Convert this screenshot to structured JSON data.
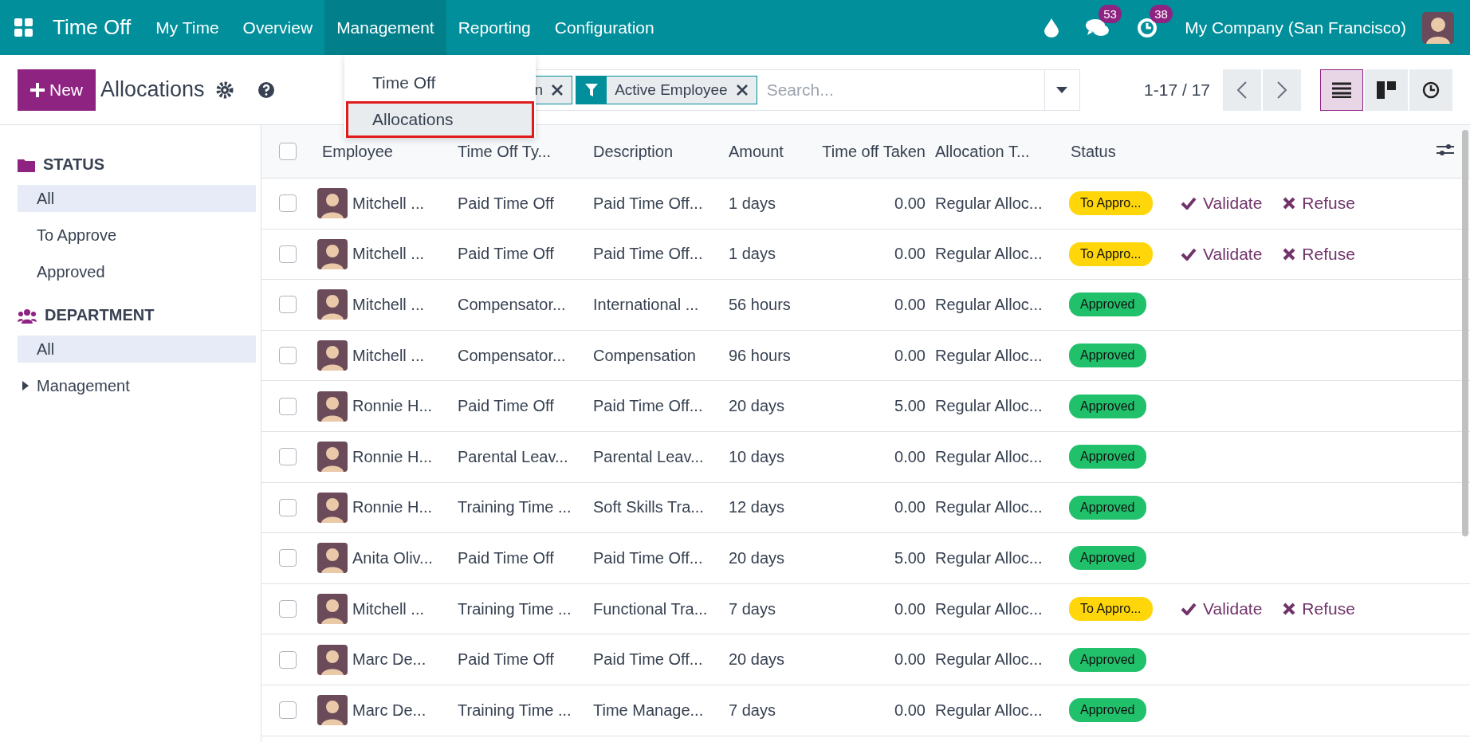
{
  "navbar": {
    "app_title": "Time Off",
    "menu": [
      {
        "label": "My Time",
        "selected": false
      },
      {
        "label": "Overview",
        "selected": false
      },
      {
        "label": "Management",
        "selected": true
      },
      {
        "label": "Reporting",
        "selected": false
      },
      {
        "label": "Configuration",
        "selected": false
      }
    ],
    "messages_badge": "53",
    "activities_badge": "38",
    "company": "My Company (San Francisco)"
  },
  "dropdown": {
    "items": [
      {
        "label": "Time Off",
        "selected": false
      },
      {
        "label": "Allocations",
        "selected": true
      }
    ]
  },
  "control_panel": {
    "new_button": "New",
    "title": "Allocations",
    "facets": [
      {
        "label": "n"
      },
      {
        "label": "Active Employee",
        "kind": "filter"
      }
    ],
    "search": {
      "placeholder": "Search..."
    },
    "pager": "1-17 / 17",
    "views": [
      {
        "kind": "list",
        "selected": true
      },
      {
        "kind": "kanban",
        "selected": false
      },
      {
        "kind": "activity",
        "selected": false
      }
    ]
  },
  "sidebar": [
    {
      "title": "STATUS",
      "kind": "folder",
      "items": [
        {
          "label": "All",
          "selected": true
        },
        {
          "label": "To Approve",
          "selected": false
        },
        {
          "label": "Approved",
          "selected": false
        }
      ]
    },
    {
      "title": "DEPARTMENT",
      "kind": "users",
      "items": [
        {
          "label": "All",
          "selected": true
        },
        {
          "label": "Management",
          "selected": false,
          "expanded": false
        }
      ]
    }
  ],
  "table": {
    "select_all_checked": false,
    "columns": [
      "Employee",
      "Time Off Ty...",
      "Description",
      "Amount",
      "Time off Taken",
      "Allocation T...",
      "Status"
    ],
    "rows": [
      {
        "checked": false,
        "employee": "Mitchell ...",
        "type": "Paid Time Off",
        "description": "Paid Time Off...",
        "amount": "1 days",
        "taken": "0.00",
        "allocation": "Regular Alloc...",
        "status": "To Appro...",
        "color": "#ffd60a",
        "actions": [
          "Validate",
          "Refuse"
        ]
      },
      {
        "checked": false,
        "employee": "Mitchell ...",
        "type": "Paid Time Off",
        "description": "Paid Time Off...",
        "amount": "1 days",
        "taken": "0.00",
        "allocation": "Regular Alloc...",
        "status": "To Appro...",
        "color": "#ffd60a",
        "actions": [
          "Validate",
          "Refuse"
        ]
      },
      {
        "checked": false,
        "employee": "Mitchell ...",
        "type": "Compensator...",
        "description": "International ...",
        "amount": "56 hours",
        "taken": "0.00",
        "allocation": "Regular Alloc...",
        "status": "Approved",
        "color": "#21c16b"
      },
      {
        "checked": false,
        "employee": "Mitchell ...",
        "type": "Compensator...",
        "description": "Compensation",
        "amount": "96 hours",
        "taken": "0.00",
        "allocation": "Regular Alloc...",
        "status": "Approved",
        "color": "#21c16b"
      },
      {
        "checked": false,
        "employee": "Ronnie H...",
        "type": "Paid Time Off",
        "description": "Paid Time Off...",
        "amount": "20 days",
        "taken": "5.00",
        "allocation": "Regular Alloc...",
        "status": "Approved",
        "color": "#21c16b"
      },
      {
        "checked": false,
        "employee": "Ronnie H...",
        "type": "Parental Leav...",
        "description": "Parental Leav...",
        "amount": "10 days",
        "taken": "0.00",
        "allocation": "Regular Alloc...",
        "status": "Approved",
        "color": "#21c16b"
      },
      {
        "checked": false,
        "employee": "Ronnie H...",
        "type": "Training Time ...",
        "description": "Soft Skills Tra...",
        "amount": "12 days",
        "taken": "0.00",
        "allocation": "Regular Alloc...",
        "status": "Approved",
        "color": "#21c16b"
      },
      {
        "checked": false,
        "employee": "Anita Oliv...",
        "type": "Paid Time Off",
        "description": "Paid Time Off...",
        "amount": "20 days",
        "taken": "5.00",
        "allocation": "Regular Alloc...",
        "status": "Approved",
        "color": "#21c16b"
      },
      {
        "checked": false,
        "employee": "Mitchell ...",
        "type": "Training Time ...",
        "description": "Functional Tra...",
        "amount": "7 days",
        "taken": "0.00",
        "allocation": "Regular Alloc...",
        "status": "To Appro...",
        "color": "#ffd60a",
        "actions": [
          "Validate",
          "Refuse"
        ]
      },
      {
        "checked": false,
        "employee": "Marc De...",
        "type": "Paid Time Off",
        "description": "Paid Time Off...",
        "amount": "20 days",
        "taken": "0.00",
        "allocation": "Regular Alloc...",
        "status": "Approved",
        "color": "#21c16b"
      },
      {
        "checked": false,
        "employee": "Marc De...",
        "type": "Training Time ...",
        "description": "Time Manage...",
        "amount": "7 days",
        "taken": "0.00",
        "allocation": "Regular Alloc...",
        "status": "Approved",
        "color": "#21c16b"
      }
    ]
  }
}
